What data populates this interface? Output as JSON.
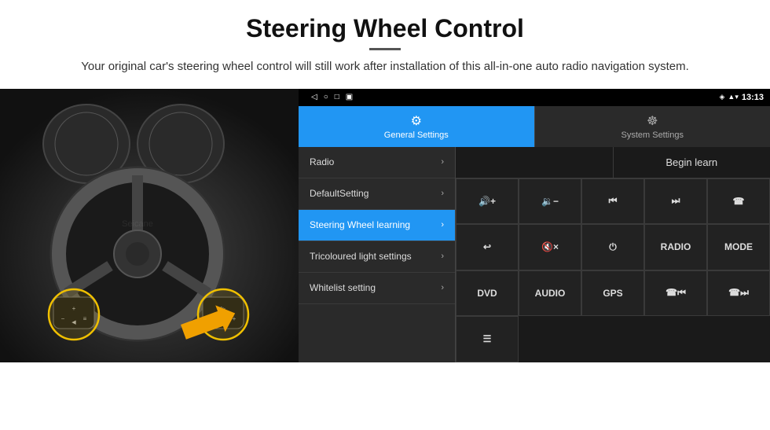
{
  "header": {
    "title": "Steering Wheel Control",
    "subtitle": "Your original car's steering wheel control will still work after installation of this all-in-one auto radio navigation system."
  },
  "status_bar": {
    "time": "13:13",
    "signal_icon": "▾▾",
    "wifi_icon": "▲",
    "location_icon": "◈"
  },
  "nav_bar": {
    "back_icon": "◁",
    "home_icon": "○",
    "recent_icon": "□",
    "cast_icon": "▣"
  },
  "tabs": [
    {
      "id": "general",
      "label": "General Settings",
      "icon": "⚙",
      "active": true
    },
    {
      "id": "system",
      "label": "System Settings",
      "icon": "☸",
      "active": false
    }
  ],
  "menu_items": [
    {
      "id": "radio",
      "label": "Radio",
      "active": false
    },
    {
      "id": "default",
      "label": "DefaultSetting",
      "active": false
    },
    {
      "id": "steering",
      "label": "Steering Wheel learning",
      "active": true
    },
    {
      "id": "tricolour",
      "label": "Tricoloured light settings",
      "active": false
    },
    {
      "id": "whitelist",
      "label": "Whitelist setting",
      "active": false
    }
  ],
  "begin_learn_label": "Begin learn",
  "control_buttons": [
    {
      "id": "vol-up",
      "label": "🔊+",
      "symbol": "VOL+"
    },
    {
      "id": "vol-down",
      "label": "🔉-",
      "symbol": "VOL−"
    },
    {
      "id": "prev-track",
      "label": "|◀◀",
      "symbol": "⏮"
    },
    {
      "id": "next-track",
      "label": "▶▶|",
      "symbol": "⏭"
    },
    {
      "id": "phone",
      "label": "📞",
      "symbol": "☎"
    },
    {
      "id": "hook",
      "label": "↩",
      "symbol": "⌐"
    },
    {
      "id": "mute",
      "label": "🔇",
      "symbol": "🔇×"
    },
    {
      "id": "power",
      "label": "⏻",
      "symbol": "⏻"
    },
    {
      "id": "radio-btn",
      "label": "RADIO",
      "symbol": "RADIO"
    },
    {
      "id": "mode",
      "label": "MODE",
      "symbol": "MODE"
    },
    {
      "id": "dvd",
      "label": "DVD",
      "symbol": "DVD"
    },
    {
      "id": "audio",
      "label": "AUDIO",
      "symbol": "AUDIO"
    },
    {
      "id": "gps",
      "label": "GPS",
      "symbol": "GPS"
    },
    {
      "id": "tel-prev",
      "label": "☎⏮",
      "symbol": "☎⏮"
    },
    {
      "id": "tel-next",
      "label": "☎⏭",
      "symbol": "☎⏭"
    },
    {
      "id": "list-icon",
      "label": "≡",
      "symbol": "☰"
    }
  ]
}
